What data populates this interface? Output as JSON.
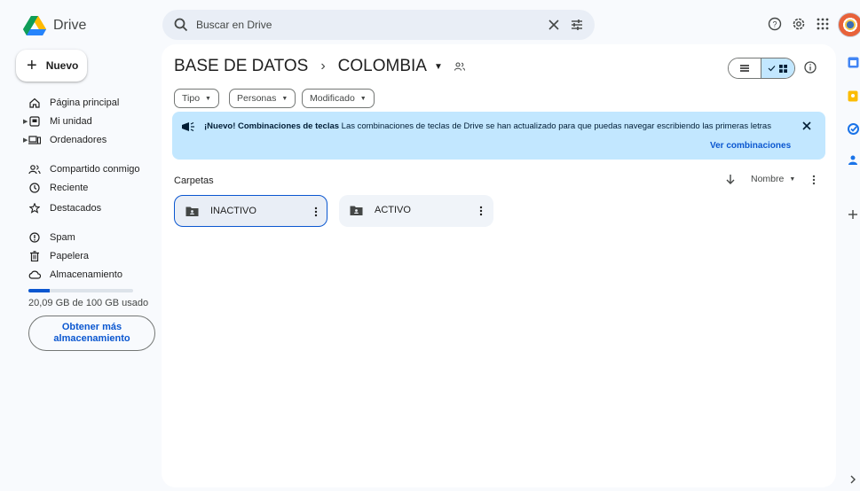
{
  "app": {
    "title": "Drive"
  },
  "search": {
    "placeholder": "Buscar en Drive"
  },
  "sidebar": {
    "new_label": "Nuevo",
    "items": [
      {
        "label": "Página principal",
        "icon": "home-icon"
      },
      {
        "label": "Mi unidad",
        "icon": "my-drive-icon"
      },
      {
        "label": "Ordenadores",
        "icon": "computers-icon"
      },
      {
        "label": "Compartido conmigo",
        "icon": "shared-icon"
      },
      {
        "label": "Reciente",
        "icon": "clock-icon"
      },
      {
        "label": "Destacados",
        "icon": "star-icon"
      },
      {
        "label": "Spam",
        "icon": "spam-icon"
      },
      {
        "label": "Papelera",
        "icon": "trash-icon"
      },
      {
        "label": "Almacenamiento",
        "icon": "cloud-icon"
      }
    ],
    "storage": {
      "used_fraction": 0.2009,
      "text": "20,09 GB de 100 GB usado",
      "get_more_line1": "Obtener más",
      "get_more_line2": "almacenamiento"
    }
  },
  "main": {
    "breadcrumb": {
      "parent": "BASE DE DATOS",
      "separator": "›",
      "current": "COLOMBIA"
    },
    "filters": [
      {
        "label": "Tipo"
      },
      {
        "label": "Personas"
      },
      {
        "label": "Modificado"
      }
    ],
    "banner": {
      "title": "¡Nuevo! Combinaciones de teclas",
      "text": " Las combinaciones de teclas de Drive se han actualizado para que puedas navegar escribiendo las primeras letras",
      "link": "Ver combinaciones"
    },
    "section_title": "Carpetas",
    "sort_label": "Nombre",
    "folders": [
      {
        "name": "INACTIVO",
        "selected": true
      },
      {
        "name": "ACTIVO",
        "selected": false
      }
    ]
  },
  "colors": {
    "accent": "#0b57d0",
    "banner_bg": "#c2e7ff",
    "search_bg": "#e9eef6",
    "page_bg": "#f8fafd"
  }
}
